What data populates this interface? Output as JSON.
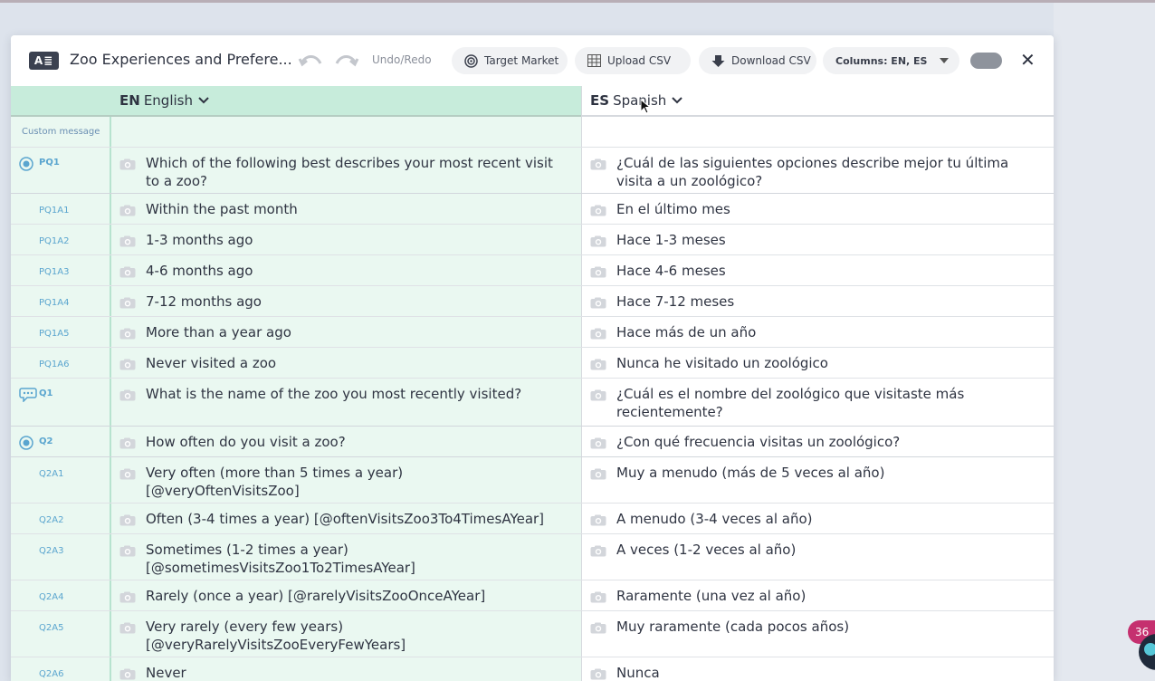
{
  "toolbar": {
    "logo": "A≣",
    "title": "Zoo Experiences and Prefere...",
    "undo_redo": "Undo/Redo",
    "target_market": "Target Market",
    "upload_csv": "Upload CSV",
    "download_csv": "Download CSV",
    "columns": "Columns: EN, ES"
  },
  "columns": {
    "en": {
      "code": "EN",
      "name": "English"
    },
    "es": {
      "code": "ES",
      "name": "Spanish"
    }
  },
  "rows": [
    {
      "id": "Custom message",
      "kind": "custom",
      "en": "",
      "es": ""
    },
    {
      "id": "PQ1",
      "kind": "question",
      "icon": "radio",
      "en": "Which of the following best describes your most recent visit\nto a zoo?",
      "es": "¿Cuál de las siguientes opciones describe mejor tu última\nvisita a un zoológico?"
    },
    {
      "id": "PQ1A1",
      "kind": "answer",
      "en": "Within the past month",
      "es": "En el último mes"
    },
    {
      "id": "PQ1A2",
      "kind": "answer",
      "en": "1-3 months ago",
      "es": "Hace 1-3 meses"
    },
    {
      "id": "PQ1A3",
      "kind": "answer",
      "en": "4-6 months ago",
      "es": "Hace 4-6 meses"
    },
    {
      "id": "PQ1A4",
      "kind": "answer",
      "en": "7-12 months ago",
      "es": "Hace 7-12 meses"
    },
    {
      "id": "PQ1A5",
      "kind": "answer",
      "en": "More than a year ago",
      "es": "Hace más de un año"
    },
    {
      "id": "PQ1A6",
      "kind": "answer",
      "en": "Never visited a zoo",
      "es": "Nunca he visitado un zoológico"
    },
    {
      "id": "Q1",
      "kind": "question",
      "icon": "chat",
      "en": "What is the name of the zoo you most recently visited?",
      "es": "¿Cuál es el nombre del zoológico que visitaste más\nrecientemente?"
    },
    {
      "id": "Q2",
      "kind": "question",
      "icon": "radio",
      "en": "How often do you visit a zoo?",
      "es": "¿Con qué frecuencia visitas un zoológico?"
    },
    {
      "id": "Q2A1",
      "kind": "answer",
      "en": "Very often (more than 5 times a year)\n[@veryOftenVisitsZoo]",
      "es": "Muy a menudo (más de 5 veces al año)"
    },
    {
      "id": "Q2A2",
      "kind": "answer",
      "en": "Often (3-4 times a year) [@oftenVisitsZoo3To4TimesAYear]",
      "es": "A menudo (3-4 veces al año)"
    },
    {
      "id": "Q2A3",
      "kind": "answer",
      "en": "Sometimes (1-2 times a year)\n[@sometimesVisitsZoo1To2TimesAYear]",
      "es": "A veces (1-2 veces al año)"
    },
    {
      "id": "Q2A4",
      "kind": "answer",
      "en": "Rarely (once a year) [@rarelyVisitsZooOnceAYear]",
      "es": "Raramente (una vez al año)"
    },
    {
      "id": "Q2A5",
      "kind": "answer",
      "en": "Very rarely (every few years)\n[@veryRarelyVisitsZooEveryFewYears]",
      "es": "Muy raramente (cada pocos años)"
    },
    {
      "id": "Q2A6",
      "kind": "answer",
      "en": "Never",
      "es": "Nunca"
    }
  ],
  "notification_count": "36",
  "colors": {
    "accent_green": "#c7ecdb",
    "id_blue": "#5aa5cf",
    "badge": "#c5306f"
  }
}
